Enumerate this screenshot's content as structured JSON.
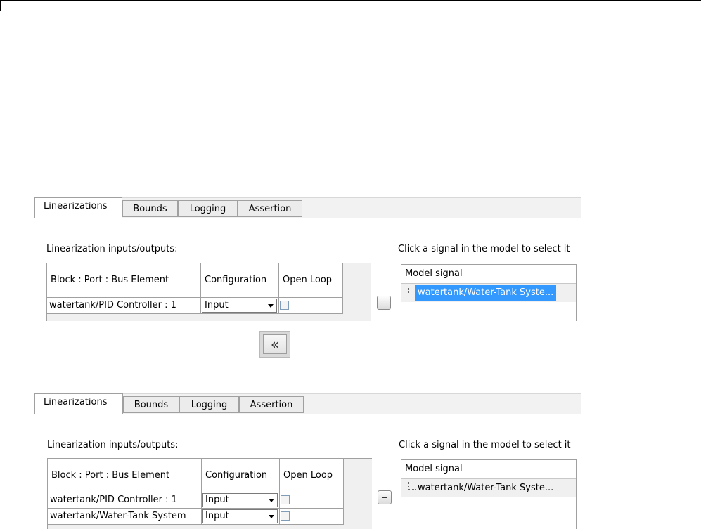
{
  "tabs": [
    "Linearizations",
    "Bounds",
    "Logging",
    "Assertion"
  ],
  "labels": {
    "io_title": "Linearization inputs/outputs:",
    "select_hint": "Click a signal in the model to select it"
  },
  "table": {
    "columns": [
      "Block : Port : Bus Element",
      "Configuration",
      "Open Loop"
    ]
  },
  "tree_header": "Model signal",
  "move_button": {
    "glyph": "«"
  },
  "before": {
    "rows": [
      {
        "block": "watertank/PID Controller : 1",
        "configuration": "Input",
        "open_loop": false
      }
    ],
    "tree_items": [
      {
        "label": "watertank/Water-Tank Syste...",
        "selected": true
      }
    ]
  },
  "after": {
    "rows": [
      {
        "block": "watertank/PID Controller : 1",
        "configuration": "Input",
        "open_loop": false
      },
      {
        "block": "watertank/Water-Tank System",
        "configuration": "Input",
        "open_loop": false
      }
    ],
    "tree_items": [
      {
        "label": "watertank/Water-Tank Syste...",
        "selected": false
      }
    ]
  },
  "colors": {
    "selection": "#3399ff",
    "grid_border": "#a0a0a0",
    "tab_strip": "#f2f2f2"
  }
}
